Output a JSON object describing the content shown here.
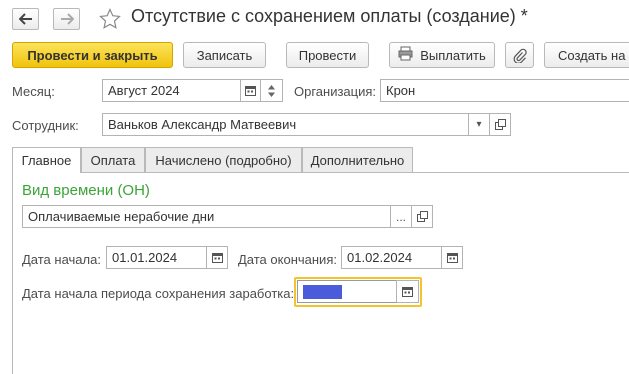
{
  "window": {
    "title": "Отсутствие с сохранением оплаты (создание) *"
  },
  "toolbar": {
    "post_close_label": "Провести и закрыть",
    "save_label": "Записать",
    "post_label": "Провести",
    "pay_label": "Выплатить",
    "create_based_label": "Создать на"
  },
  "header": {
    "month_label": "Месяц:",
    "month_value": "Август 2024",
    "organization_label": "Организация:",
    "organization_value": "Крон",
    "employee_label": "Сотрудник:",
    "employee_value": "Ваньков Александр Матвеевич"
  },
  "tabs": [
    {
      "label": "Главное",
      "active": true
    },
    {
      "label": "Оплата",
      "active": false
    },
    {
      "label": "Начислено (подробно)",
      "active": false
    },
    {
      "label": "Дополнительно",
      "active": false
    }
  ],
  "main": {
    "time_type_heading": "Вид времени (ОН)",
    "time_type_value": "Оплачиваемые нерабочие дни",
    "start_date_label": "Дата начала:",
    "start_date_value": "01.01.2024",
    "end_date_label": "Дата окончания:",
    "end_date_value": "01.02.2024",
    "earnings_start_label": "Дата начала периода сохранения заработка:",
    "earnings_start_value": ""
  },
  "buttons": {
    "ellipsis": "...",
    "dropdown_arrow": "▾"
  },
  "colors": {
    "primary_button": "#f1c30d",
    "section_heading": "#3aa537",
    "focus_border": "#f5c42c",
    "selection": "#4a5cd9"
  },
  "icons": [
    "back-arrow-icon",
    "forward-arrow-icon",
    "star-icon",
    "print-icon",
    "paperclip-icon",
    "calendar-icon",
    "open-link-icon",
    "spinner-icon",
    "dropdown-icon"
  ]
}
